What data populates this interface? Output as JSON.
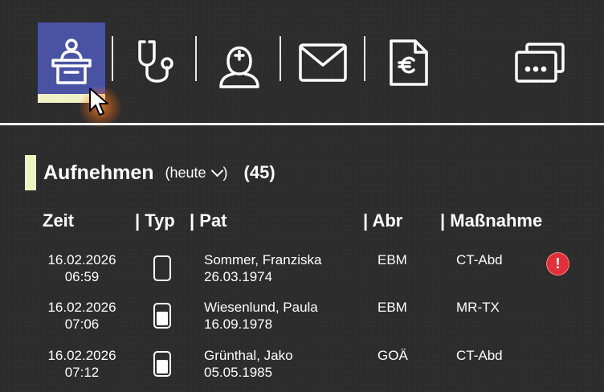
{
  "toolbar": {
    "buttons": [
      {
        "icon": "reception-desk-icon",
        "active": true
      },
      {
        "icon": "stethoscope-icon"
      },
      {
        "icon": "doctor-icon"
      },
      {
        "icon": "mail-icon"
      },
      {
        "icon": "invoice-euro-icon"
      },
      {
        "icon": "more-windows-icon"
      }
    ],
    "active_color": "#4a53a3",
    "active_underline_color": "#f0f3c8"
  },
  "section": {
    "title": "Aufnehmen",
    "filter": "(heute",
    "filter_close": ")",
    "count": "(45)",
    "accent_color": "#eef3c0"
  },
  "table": {
    "headers": {
      "zeit": "Zeit",
      "typ": "| Typ",
      "pat": "| Pat",
      "abr": "| Abr",
      "massnahme": "| Maßnahme"
    },
    "rows": [
      {
        "date": "16.02.2026",
        "time": "06:59",
        "type_icon": "phone-empty-icon",
        "name": "Sommer, Franziska",
        "dob": "26.03.1974",
        "abr": "EBM",
        "massnahme": "CT-Abd",
        "warning": "!"
      },
      {
        "date": "16.02.2026",
        "time": "07:06",
        "type_icon": "phone-filled-icon",
        "name": "Wiesenlund, Paula",
        "dob": "16.09.1978",
        "abr": "EBM",
        "massnahme": "MR-TX"
      },
      {
        "date": "16.02.2026",
        "time": "07:12",
        "type_icon": "phone-filled-icon",
        "name": "Grünthal, Jako",
        "dob": "05.05.1985",
        "abr": "GOÄ",
        "massnahme": "CT-Abd"
      }
    ]
  },
  "colors": {
    "background": "#2b2b2b",
    "warning": "#e0303a"
  }
}
